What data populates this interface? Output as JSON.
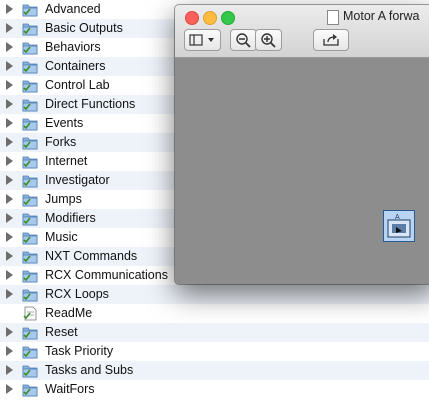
{
  "items": [
    {
      "label": "Advanced",
      "type": "folder"
    },
    {
      "label": "Basic Outputs",
      "type": "folder"
    },
    {
      "label": "Behaviors",
      "type": "folder"
    },
    {
      "label": "Containers",
      "type": "folder"
    },
    {
      "label": "Control Lab",
      "type": "folder"
    },
    {
      "label": "Direct Functions",
      "type": "folder"
    },
    {
      "label": "Events",
      "type": "folder"
    },
    {
      "label": "Forks",
      "type": "folder"
    },
    {
      "label": "Internet",
      "type": "folder"
    },
    {
      "label": "Investigator",
      "type": "folder"
    },
    {
      "label": "Jumps",
      "type": "folder"
    },
    {
      "label": "Modifiers",
      "type": "folder"
    },
    {
      "label": "Music",
      "type": "folder"
    },
    {
      "label": "NXT Commands",
      "type": "folder"
    },
    {
      "label": "RCX Communications",
      "type": "folder"
    },
    {
      "label": "RCX Loops",
      "type": "folder"
    },
    {
      "label": "ReadMe",
      "type": "file"
    },
    {
      "label": "Reset",
      "type": "folder"
    },
    {
      "label": "Task Priority",
      "type": "folder"
    },
    {
      "label": "Tasks and Subs",
      "type": "folder"
    },
    {
      "label": "WaitFors",
      "type": "folder"
    }
  ],
  "preview_window": {
    "title": "Motor A forwa",
    "toolbar": {
      "sidebar_icon": "sidebar-toggle-icon",
      "zoom_out_icon": "zoom-out-icon",
      "zoom_in_icon": "zoom-in-icon",
      "share_icon": "share-icon"
    }
  },
  "colors": {
    "row_alt": "#eef3fa",
    "folder": "#8ab3dd",
    "window_bg": "#8d8d8d",
    "block": "#b9d3f2"
  }
}
